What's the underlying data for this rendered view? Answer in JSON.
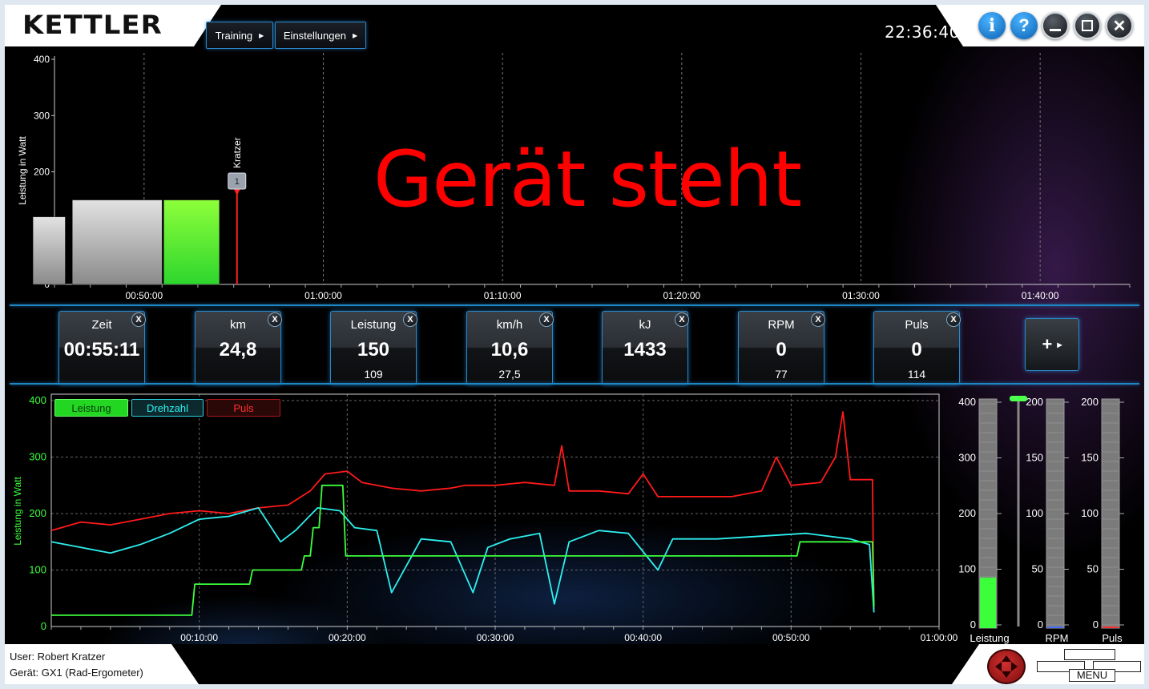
{
  "app": {
    "logo": "KETTLER",
    "menu": [
      {
        "label": "Training"
      },
      {
        "label": "Einstellungen"
      }
    ],
    "clock": "22:36:40",
    "window_buttons": {
      "info": "i",
      "help": "?"
    }
  },
  "top_chart": {
    "ylabel": "Leistung in Watt",
    "yticks": [
      "400",
      "300",
      "200",
      "100",
      "0"
    ],
    "xticks": [
      "00:50:00",
      "01:00:00",
      "01:10:00",
      "01:20:00",
      "01:30:00",
      "01:40:00"
    ],
    "marker_label": "Kratzer",
    "marker_badge": "1",
    "status": "Gerät steht",
    "bar_colors": {
      "past": "#c8c8c8",
      "current": "#7dff2a",
      "cursor": "#ff2020"
    }
  },
  "chart_data": [
    {
      "type": "bar",
      "title": "",
      "ylabel": "Leistung in Watt",
      "xlabel": "",
      "ylim": [
        0,
        400
      ],
      "x_unit": "time",
      "segments": [
        {
          "start": "00:43:48",
          "end": "00:45:36",
          "value": 120,
          "state": "past"
        },
        {
          "start": "00:46:00",
          "end": "00:51:00",
          "value": 150,
          "state": "past"
        },
        {
          "start": "00:51:06",
          "end": "00:54:12",
          "value": 150,
          "state": "current"
        }
      ],
      "markers": [
        {
          "time": "00:55:11",
          "label": "Kratzer",
          "badge": "1"
        }
      ]
    },
    {
      "type": "line",
      "title": "",
      "ylabel": "Leistung in Watt",
      "xlabel": "",
      "ylim": [
        0,
        400
      ],
      "xlim": [
        "00:00:00",
        "01:00:00"
      ],
      "x_unit": "minutes",
      "series": [
        {
          "name": "Leistung",
          "color": "#3cff3c",
          "x": [
            0,
            9.5,
            9.7,
            13.5,
            13.7,
            17.2,
            17.4,
            18,
            18.2,
            19.6,
            19.8,
            55.5,
            55.6,
            50.5,
            50.7
          ],
          "points": [
            [
              0,
              20
            ],
            [
              9.5,
              20
            ],
            [
              9.7,
              75
            ],
            [
              13.4,
              75
            ],
            [
              13.6,
              100
            ],
            [
              16.9,
              100
            ],
            [
              17.1,
              125
            ],
            [
              17.5,
              125
            ],
            [
              17.7,
              175
            ],
            [
              18.1,
              175
            ],
            [
              18.3,
              250
            ],
            [
              19.7,
              250
            ],
            [
              19.9,
              125
            ],
            [
              50.4,
              125
            ],
            [
              50.6,
              150
            ],
            [
              55.5,
              150
            ],
            [
              55.6,
              35
            ]
          ]
        },
        {
          "name": "Drehzahl",
          "color": "#2ef0f0",
          "points": [
            [
              0,
              150
            ],
            [
              2,
              140
            ],
            [
              4,
              130
            ],
            [
              6,
              145
            ],
            [
              8,
              165
            ],
            [
              10,
              190
            ],
            [
              12,
              195
            ],
            [
              14,
              210
            ],
            [
              15.5,
              150
            ],
            [
              16.5,
              170
            ],
            [
              18,
              210
            ],
            [
              19.5,
              205
            ],
            [
              20.5,
              175
            ],
            [
              22,
              170
            ],
            [
              23,
              60
            ],
            [
              25,
              155
            ],
            [
              27,
              150
            ],
            [
              28.5,
              60
            ],
            [
              29.5,
              140
            ],
            [
              31,
              155
            ],
            [
              33,
              165
            ],
            [
              34,
              40
            ],
            [
              35,
              150
            ],
            [
              37,
              170
            ],
            [
              39,
              165
            ],
            [
              41,
              100
            ],
            [
              42,
              155
            ],
            [
              45,
              155
            ],
            [
              48,
              160
            ],
            [
              51,
              165
            ],
            [
              54,
              155
            ],
            [
              55.3,
              145
            ],
            [
              55.6,
              25
            ]
          ]
        },
        {
          "name": "Puls",
          "color": "#ff1a1a",
          "points": [
            [
              0,
              170
            ],
            [
              2,
              185
            ],
            [
              4,
              180
            ],
            [
              6,
              190
            ],
            [
              8,
              200
            ],
            [
              10,
              205
            ],
            [
              12,
              200
            ],
            [
              14,
              210
            ],
            [
              16,
              215
            ],
            [
              17.5,
              240
            ],
            [
              18.5,
              270
            ],
            [
              20,
              275
            ],
            [
              21,
              255
            ],
            [
              23,
              245
            ],
            [
              25,
              240
            ],
            [
              27,
              245
            ],
            [
              28,
              250
            ],
            [
              30,
              250
            ],
            [
              32,
              255
            ],
            [
              34,
              250
            ],
            [
              34.5,
              320
            ],
            [
              35,
              240
            ],
            [
              37,
              240
            ],
            [
              39,
              235
            ],
            [
              40,
              270
            ],
            [
              41,
              230
            ],
            [
              42.5,
              230
            ],
            [
              44,
              230
            ],
            [
              46,
              230
            ],
            [
              48,
              240
            ],
            [
              49,
              300
            ],
            [
              50,
              250
            ],
            [
              52,
              255
            ],
            [
              53,
              300
            ],
            [
              53.5,
              380
            ],
            [
              54,
              260
            ],
            [
              55.5,
              260
            ],
            [
              55.6,
              30
            ]
          ]
        }
      ]
    }
  ],
  "tiles": [
    {
      "label": "Zeit",
      "value": "00:55:11",
      "sub": ""
    },
    {
      "label": "km",
      "value": "24,8",
      "sub": ""
    },
    {
      "label": "Leistung",
      "value": "150",
      "sub": "109"
    },
    {
      "label": "km/h",
      "value": "10,6",
      "sub": "27,5"
    },
    {
      "label": "kJ",
      "value": "1433",
      "sub": ""
    },
    {
      "label": "RPM",
      "value": "0",
      "sub": "77"
    },
    {
      "label": "Puls",
      "value": "0",
      "sub": "114"
    }
  ],
  "tile_close": "X",
  "add_tile": "+",
  "bottom_chart": {
    "ylabel": "Leistung in Watt",
    "yticks": [
      "400",
      "300",
      "200",
      "100",
      "0"
    ],
    "xticks": [
      "00:10:00",
      "00:20:00",
      "00:30:00",
      "00:40:00",
      "00:50:00",
      "01:00:00"
    ],
    "legend": [
      {
        "label": "Leistung",
        "color": "#3cff3c"
      },
      {
        "label": "Drehzahl",
        "color": "#2ef0f0"
      },
      {
        "label": "Puls",
        "color": "#ff1a1a"
      }
    ]
  },
  "gauges": [
    {
      "label": "Leistung",
      "ticks": [
        "400",
        "300",
        "200",
        "100",
        "0"
      ],
      "level": 0.22,
      "color": "#3cff3c"
    },
    {
      "label": "RPM",
      "ticks": [
        "200",
        "150",
        "100",
        "50",
        "0"
      ],
      "level": 0.0,
      "color": "#4a6cff"
    },
    {
      "label": "Puls",
      "ticks": [
        "200",
        "150",
        "100",
        "50",
        "0"
      ],
      "level": 0.0,
      "color": "#ff3030"
    }
  ],
  "footer": {
    "user": "User: Robert Kratzer",
    "device": "Gerät: GX1 (Rad-Ergometer)",
    "menu_label": "MENU"
  }
}
